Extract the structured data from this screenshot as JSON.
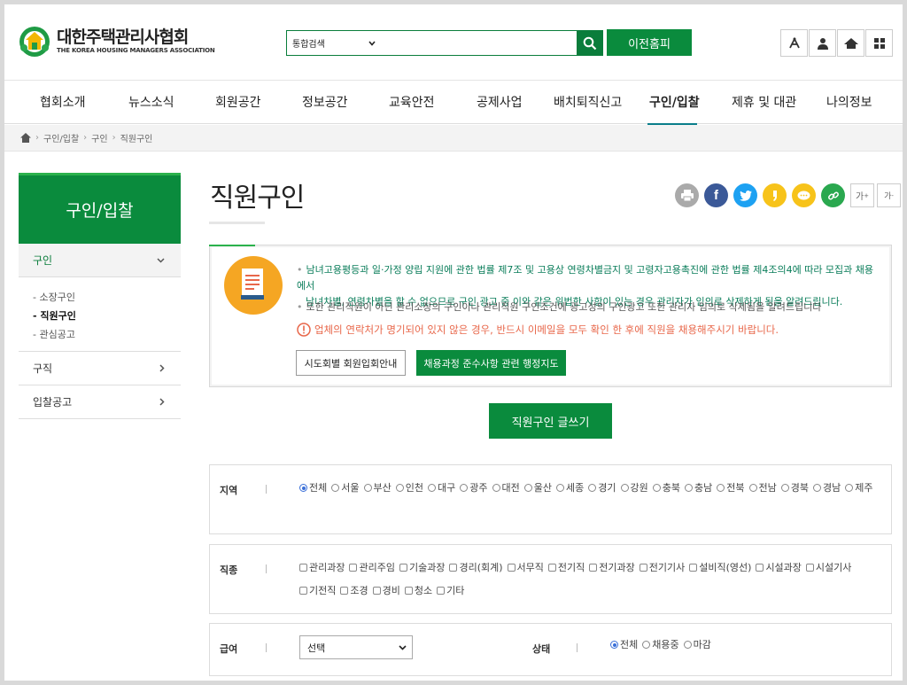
{
  "header": {
    "logo_ko": "대한주택관리사협회",
    "logo_en": "THE KOREA HOUSING MANAGERS ASSOCIATION",
    "search_select": "통합검색",
    "old_home_label": "이전홈피"
  },
  "gnb": [
    "협회소개",
    "뉴스소식",
    "회원공간",
    "정보공간",
    "교육안전",
    "공제사업",
    "배치퇴직신고",
    "구인/입찰",
    "제휴 및 대관",
    "나의정보"
  ],
  "breadcrumb": [
    "구인/입찰",
    "구인",
    "직원구인"
  ],
  "lnb": {
    "title": "구인/입찰",
    "menu1": "구인",
    "sub": [
      "소장구인",
      "직원구인",
      "관심공고"
    ],
    "menu2": "구직",
    "menu3": "입찰공고"
  },
  "page_title": "직원구인",
  "font_size": {
    "up": "가",
    "down": "가"
  },
  "notice": {
    "line1": "남녀고용평등과 일·가정 양립 지원에 관한 법률 제7조 및 고용상 연령차별금지 및 고령자고용촉진에 관한 법률 제4조의4에 따라 모집과 채용에서",
    "line2": "남녀차별, 연령차별을 할 수 없으므로 구인 광고 중 이와 같은 위법한 사항이 있는 경우 관리자가 임의로 삭제하게 됨을 알려드립니다.",
    "line3": "또한 관리직원이 아닌 관리소장의 구인이나 관리직원 구인조건에 광고성의 구인광고 또한 관리자 임의로 삭제됨을 알려드립니다",
    "warning": "업체의 연락처가 명기되어 있지 않은 경우, 반드시 이메일을 모두 확인 한 후에 직원을 채용해주시기 바랍니다.",
    "btn1": "시도회별 회원입회안내",
    "btn2": "채용과정 준수사항 관련 행정지도"
  },
  "write_button": "직원구인 글쓰기",
  "filters": {
    "region_label": "지역",
    "regions": [
      "전체",
      "서울",
      "부산",
      "인천",
      "대구",
      "광주",
      "대전",
      "울산",
      "세종",
      "경기",
      "강원",
      "충북",
      "충남",
      "전북",
      "전남",
      "경북",
      "경남",
      "제주"
    ],
    "job_label": "직종",
    "jobs": [
      "관리과장",
      "관리주임",
      "기술과장",
      "경리(회계)",
      "서무직",
      "전기직",
      "전기과장",
      "전기기사",
      "설비직(영선)",
      "시설과장",
      "시설기사",
      "기전직",
      "조경",
      "경비",
      "청소",
      "기타"
    ],
    "salary_label": "급여",
    "salary_select": "선택",
    "status_label": "상태",
    "statuses": [
      "전체",
      "채용중",
      "마감"
    ]
  },
  "colors": {
    "brand_green": "#0a8b3d",
    "accent_teal": "#0a7d8a",
    "warning": "#e8674a"
  }
}
